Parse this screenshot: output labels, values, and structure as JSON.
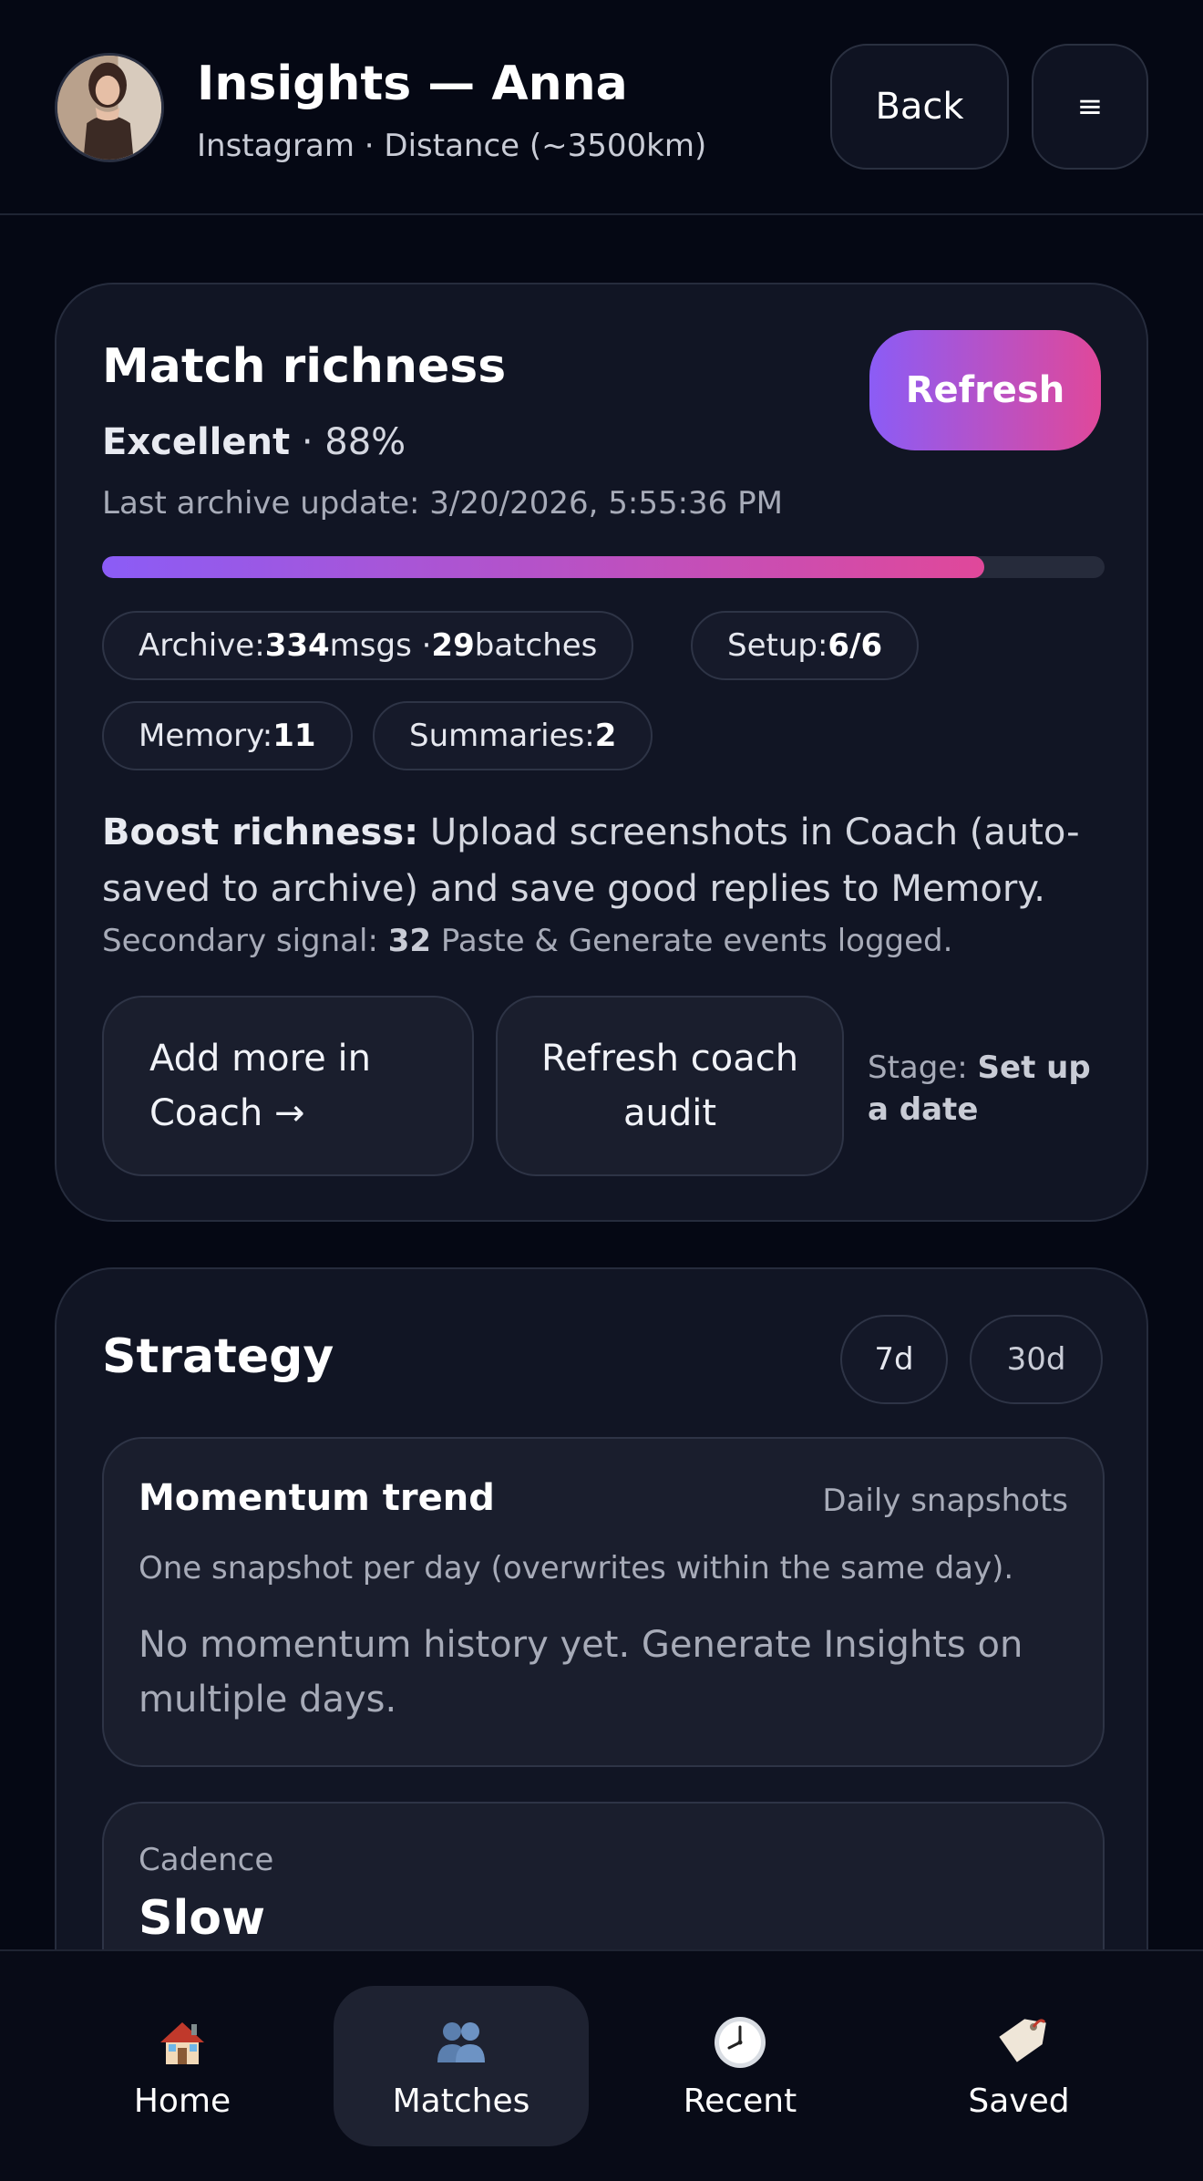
{
  "header": {
    "title": "Insights — Anna",
    "subtitle": "Instagram · Distance (~3500km)",
    "back_label": "Back",
    "menu_label": "≡"
  },
  "richness": {
    "title": "Match richness",
    "refresh_label": "Refresh",
    "rating": "Excellent",
    "separator": " · ",
    "percent": "88%",
    "percent_value": 0.88,
    "last_update": "Last archive update: 3/20/2026, 5:55:36 PM",
    "pills": {
      "archive_prefix": "Archive: ",
      "archive_msgs": "334",
      "archive_mid": " msgs · ",
      "archive_batches": "29",
      "archive_suffix": " batches",
      "setup_prefix": "Setup: ",
      "setup_value": "6/6",
      "memory_prefix": "Memory: ",
      "memory_value": "11",
      "summaries_prefix": "Summaries: ",
      "summaries_value": "2"
    },
    "boost_label": "Boost richness:",
    "boost_text": " Upload screenshots in Coach (auto-saved to archive) and save good replies to Memory.",
    "signal_prefix": "Secondary signal: ",
    "signal_count": "32",
    "signal_suffix": " Paste & Generate events logged.",
    "add_coach_label": "Add more in Coach →",
    "refresh_audit_label": "Refresh coach audit",
    "stage_prefix": "Stage: ",
    "stage_value": "Set up a date"
  },
  "strategy": {
    "title": "Strategy",
    "range_7": "7d",
    "range_30": "30d",
    "momentum": {
      "title": "Momentum trend",
      "tag": "Daily snapshots",
      "description": "One snapshot per day (overwrites within the same day).",
      "empty": "No momentum history yet. Generate Insights on multiple days."
    },
    "cadence": {
      "label": "Cadence",
      "value": "Slow"
    }
  },
  "nav": {
    "items": [
      {
        "label": "Home",
        "icon": "house-icon"
      },
      {
        "label": "Matches",
        "icon": "people-icon"
      },
      {
        "label": "Recent",
        "icon": "clock-icon"
      },
      {
        "label": "Saved",
        "icon": "tag-icon"
      }
    ],
    "active": "Matches"
  },
  "colors": {
    "background": "#050814",
    "card": "#111524",
    "accent_start": "#8b5cf6",
    "accent_end": "#e0489a"
  }
}
